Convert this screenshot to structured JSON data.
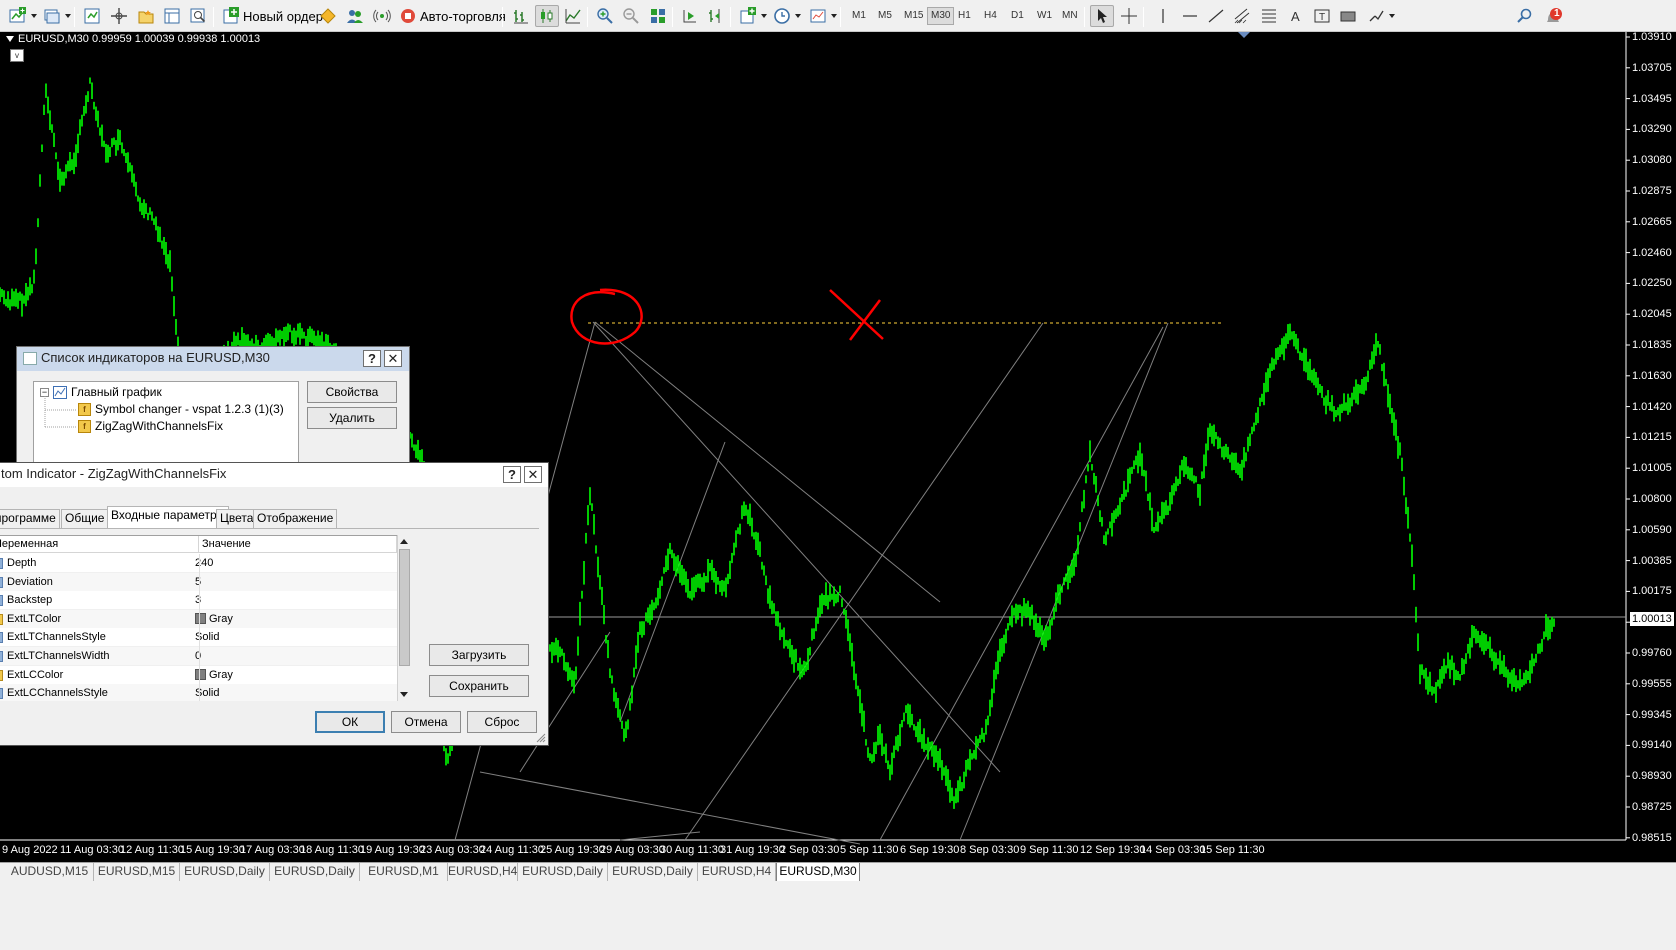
{
  "toolbar": {
    "new_order_label": "Новый ордер",
    "algo_trading_label": "Авто-торговля",
    "timeframes": [
      "M1",
      "M5",
      "M15",
      "M30",
      "H1",
      "H4",
      "D1",
      "W1",
      "MN"
    ],
    "active_timeframe": "M30",
    "notification_count": "1"
  },
  "chart": {
    "header": "EURUSD,M30  0.99959 1.00039 0.99938 1.00013",
    "vbutton": "v",
    "current_price": "1.00013",
    "price_labels": [
      "1.03910",
      "1.03705",
      "1.03495",
      "1.03290",
      "1.03080",
      "1.02875",
      "1.02665",
      "1.02460",
      "1.02250",
      "1.02045",
      "1.01835",
      "1.01630",
      "1.01420",
      "1.01215",
      "1.01005",
      "1.00800",
      "1.00590",
      "1.00385",
      "1.00175",
      "0.99970",
      "0.99760",
      "0.99555",
      "0.99345",
      "0.99140",
      "0.98930",
      "0.98725",
      "0.98515"
    ],
    "time_labels": [
      "9 Aug 2022",
      "11 Aug 03:30",
      "12 Aug 11:30",
      "15 Aug 19:30",
      "17 Aug 03:30",
      "18 Aug 11:30",
      "19 Aug 19:30",
      "23 Aug 03:30",
      "24 Aug 11:30",
      "25 Aug 19:30",
      "29 Aug 03:30",
      "30 Aug 11:30",
      "31 Aug 19:30",
      "2 Sep 03:30",
      "5 Sep 11:30",
      "6 Sep 19:30",
      "8 Sep 03:30",
      "9 Sep 11:30",
      "12 Sep 19:30",
      "14 Sep 03:30",
      "15 Sep 11:30"
    ],
    "colors": {
      "candles": "#00ff00",
      "channels": "#808080",
      "level": "#ffd23c",
      "annotation": "#ff0000"
    }
  },
  "tabs": [
    "AUDUSD,M15",
    "EURUSD,M15",
    "EURUSD,Daily",
    "EURUSD,Daily",
    "EURUSD,M1",
    "EURUSD,H4",
    "EURUSD,Daily",
    "EURUSD,Daily",
    "EURUSD,H4",
    "EURUSD,M30"
  ],
  "active_tab": "EURUSD,M30",
  "indicator_list": {
    "title": "Список индикаторов на EURUSD,M30",
    "help": "?",
    "close": "✕",
    "tree": {
      "root": "Главный график",
      "items": [
        "Symbol changer - vspat 1.2.3 (1)(3)",
        "ZigZagWithChannelsFix"
      ]
    },
    "properties_button": "Свойства",
    "delete_button": "Удалить"
  },
  "custom_indicator": {
    "title": "tom Indicator - ZigZagWithChannelsFix",
    "help": "?",
    "close": "✕",
    "tabs": [
      "программе",
      "Общие",
      "Входные параметры",
      "Цвета",
      "Отображение"
    ],
    "active_tab": "Входные параметры",
    "columns": [
      "Переменная",
      "Значение"
    ],
    "params": [
      {
        "name": "Depth",
        "value": "240",
        "type": "int"
      },
      {
        "name": "Deviation",
        "value": "5",
        "type": "int"
      },
      {
        "name": "Backstep",
        "value": "3",
        "type": "int"
      },
      {
        "name": "ExtLTColor",
        "value": "Gray",
        "type": "color"
      },
      {
        "name": "ExtLTChannelsStyle",
        "value": "Solid",
        "type": "int"
      },
      {
        "name": "ExtLTChannelsWidth",
        "value": "0",
        "type": "int"
      },
      {
        "name": "ExtLCColor",
        "value": "Gray",
        "type": "color"
      },
      {
        "name": "ExtLCChannelsStyle",
        "value": "Solid",
        "type": "int"
      },
      {
        "name": "ExtLCChannelsWidth",
        "value": "0",
        "type": "int"
      }
    ],
    "load_button": "Загрузить",
    "save_button": "Сохранить",
    "ok_button": "ОК",
    "cancel_button": "Отмена",
    "reset_button": "Сброс"
  }
}
